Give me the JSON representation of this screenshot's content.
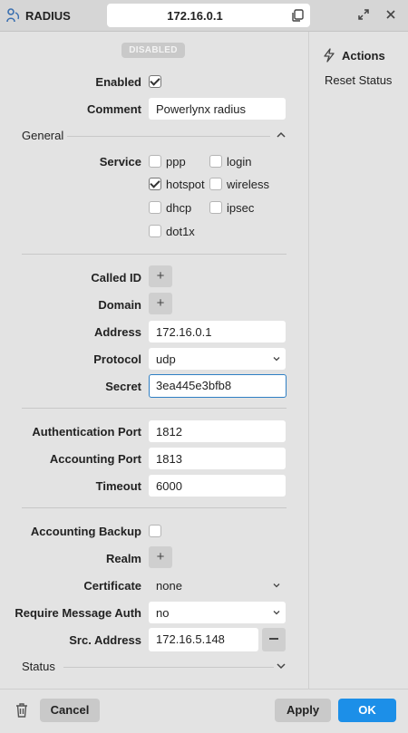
{
  "window": {
    "title": "RADIUS",
    "address": "172.16.0.1"
  },
  "status_badge": "DISABLED",
  "sidebar": {
    "actions_title": "Actions",
    "reset_status": "Reset Status"
  },
  "form": {
    "enabled_label": "Enabled",
    "enabled": true,
    "comment_label": "Comment",
    "comment_value": "Powerlynx radius",
    "general_section": "General",
    "service_label": "Service",
    "services": [
      {
        "label": "ppp",
        "checked": false
      },
      {
        "label": "login",
        "checked": false
      },
      {
        "label": "hotspot",
        "checked": true
      },
      {
        "label": "wireless",
        "checked": false
      },
      {
        "label": "dhcp",
        "checked": false
      },
      {
        "label": "ipsec",
        "checked": false
      },
      {
        "label": "dot1x",
        "checked": false
      }
    ],
    "called_id_label": "Called ID",
    "domain_label": "Domain",
    "add_glyph": "+",
    "address_label": "Address",
    "address_value": "172.16.0.1",
    "protocol_label": "Protocol",
    "protocol_value": "udp",
    "secret_label": "Secret",
    "secret_value": "3ea445e3bfb8",
    "auth_port_label": "Authentication Port",
    "auth_port_value": "1812",
    "acct_port_label": "Accounting Port",
    "acct_port_value": "1813",
    "timeout_label": "Timeout",
    "timeout_value": "6000",
    "acct_backup_label": "Accounting Backup",
    "acct_backup": false,
    "realm_label": "Realm",
    "certificate_label": "Certificate",
    "certificate_value": "none",
    "req_msg_auth_label": "Require Message Auth",
    "req_msg_auth_value": "no",
    "src_address_label": "Src. Address",
    "src_address_value": "172.16.5.148",
    "status_section": "Status"
  },
  "footer": {
    "cancel": "Cancel",
    "apply": "Apply",
    "ok": "OK"
  },
  "colors": {
    "accent": "#1c8fe8",
    "focus": "#2f7fc4"
  }
}
